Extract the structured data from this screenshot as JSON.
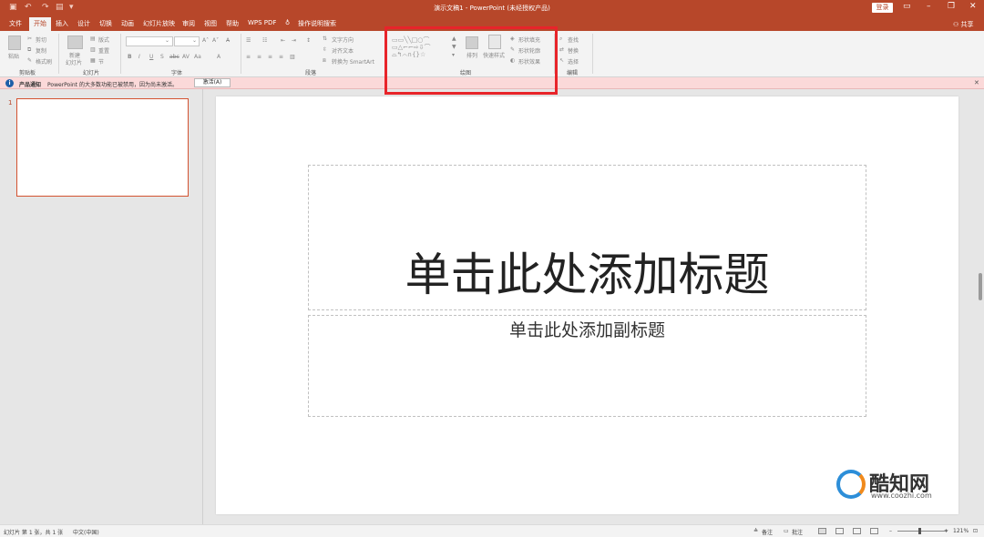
{
  "app": {
    "window_title": "演示文稿1  -  PowerPoint (未经授权产品)",
    "login_label": "登录",
    "share_label": "共享"
  },
  "menu": {
    "file": "文件",
    "home": "开始",
    "insert": "插入",
    "design": "设计",
    "transitions": "切换",
    "animations": "动画",
    "slideshow": "幻灯片放映",
    "review": "审阅",
    "view": "视图",
    "help": "帮助",
    "wpspdf": "WPS PDF",
    "tellme": "操作说明搜索"
  },
  "ribbon": {
    "clipboard": {
      "label": "剪贴板",
      "paste": "粘贴",
      "cut": "剪切",
      "copy": "复制",
      "format_painter": "格式刷"
    },
    "slides": {
      "label": "幻灯片",
      "new_slide": "新建",
      "new_slide2": "幻灯片",
      "layout": "版式",
      "reset": "重置",
      "section": "节"
    },
    "font": {
      "label": "字体"
    },
    "paragraph": {
      "label": "段落",
      "text_direction": "文字方向",
      "align_text": "对齐文本",
      "smartart": "转换为 SmartArt"
    },
    "drawing": {
      "label": "绘图",
      "arrange": "排列",
      "quick_styles": "快速样式",
      "shape_fill": "形状填充",
      "shape_outline": "形状轮廓",
      "shape_effects": "形状效果"
    },
    "editing": {
      "label": "编辑",
      "find": "查找",
      "replace": "替换",
      "select": "选择"
    }
  },
  "notification": {
    "title": "产品通知",
    "message": "PowerPoint 的大多数功能已被禁用，因为尚未激活。",
    "button": "激活(A)"
  },
  "thumbnails": [
    {
      "number": "1"
    }
  ],
  "slide": {
    "title_placeholder": "单击此处添加标题",
    "subtitle_placeholder": "单击此处添加副标题"
  },
  "statusbar": {
    "slide_info": "幻灯片 第 1 张，共 1 张",
    "language": "中文(中国)",
    "notes": "备注",
    "comments": "批注",
    "zoom": "121%"
  },
  "watermark": {
    "name": "酷知网",
    "url": "www.coozhi.com"
  },
  "colors": {
    "accent": "#b7472a",
    "highlight": "#e8242a"
  }
}
